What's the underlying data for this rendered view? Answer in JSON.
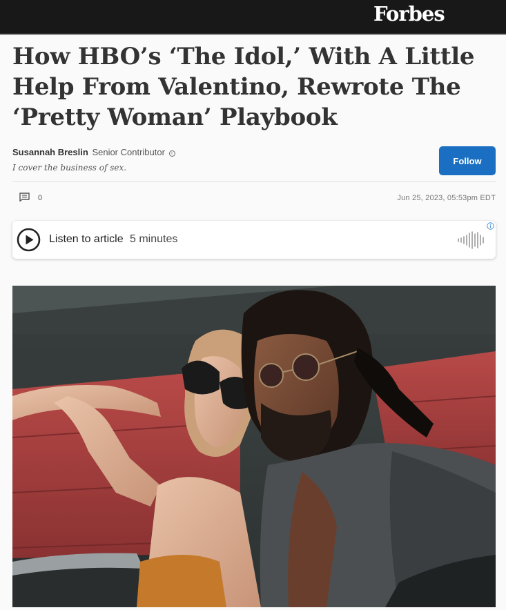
{
  "header": {
    "logo": "Forbes"
  },
  "article": {
    "headline": "How HBO’s ‘The Idol,’ With A Little Help From Valentino, Rewrote The ‘Pretty Woman’ Playbook",
    "author": {
      "name": "Susannah Breslin",
      "role": "Senior Contributor",
      "tagline": "I cover the business of sex."
    },
    "follow_label": "Follow",
    "comment_count": "0",
    "date": "Jun 25, 2023, 05:53pm EDT"
  },
  "listen": {
    "label": "Listen to article",
    "duration": "5 minutes"
  },
  "colors": {
    "topbar": "#181818",
    "follow_button": "#1a6fc2",
    "page_bg": "#fafafa"
  },
  "icons": [
    "comment-icon",
    "info-icon",
    "play-icon",
    "audio-wave-icon",
    "ad-info-icon"
  ]
}
